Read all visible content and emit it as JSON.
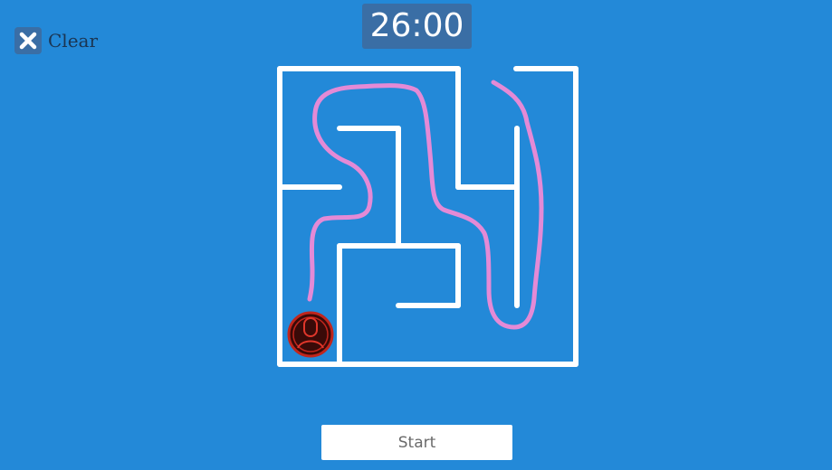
{
  "toolbar": {
    "clear_label": "Clear",
    "clear_icon": "close-x-icon"
  },
  "timer": {
    "value": "26:00"
  },
  "start_button": {
    "label": "Start"
  },
  "maze": {
    "wall_color": "#ffffff",
    "path_color": "#e48ad6",
    "background_color": "#2389d8",
    "player_icon": "user-avatar-icon",
    "player_color": "#c0261d"
  }
}
